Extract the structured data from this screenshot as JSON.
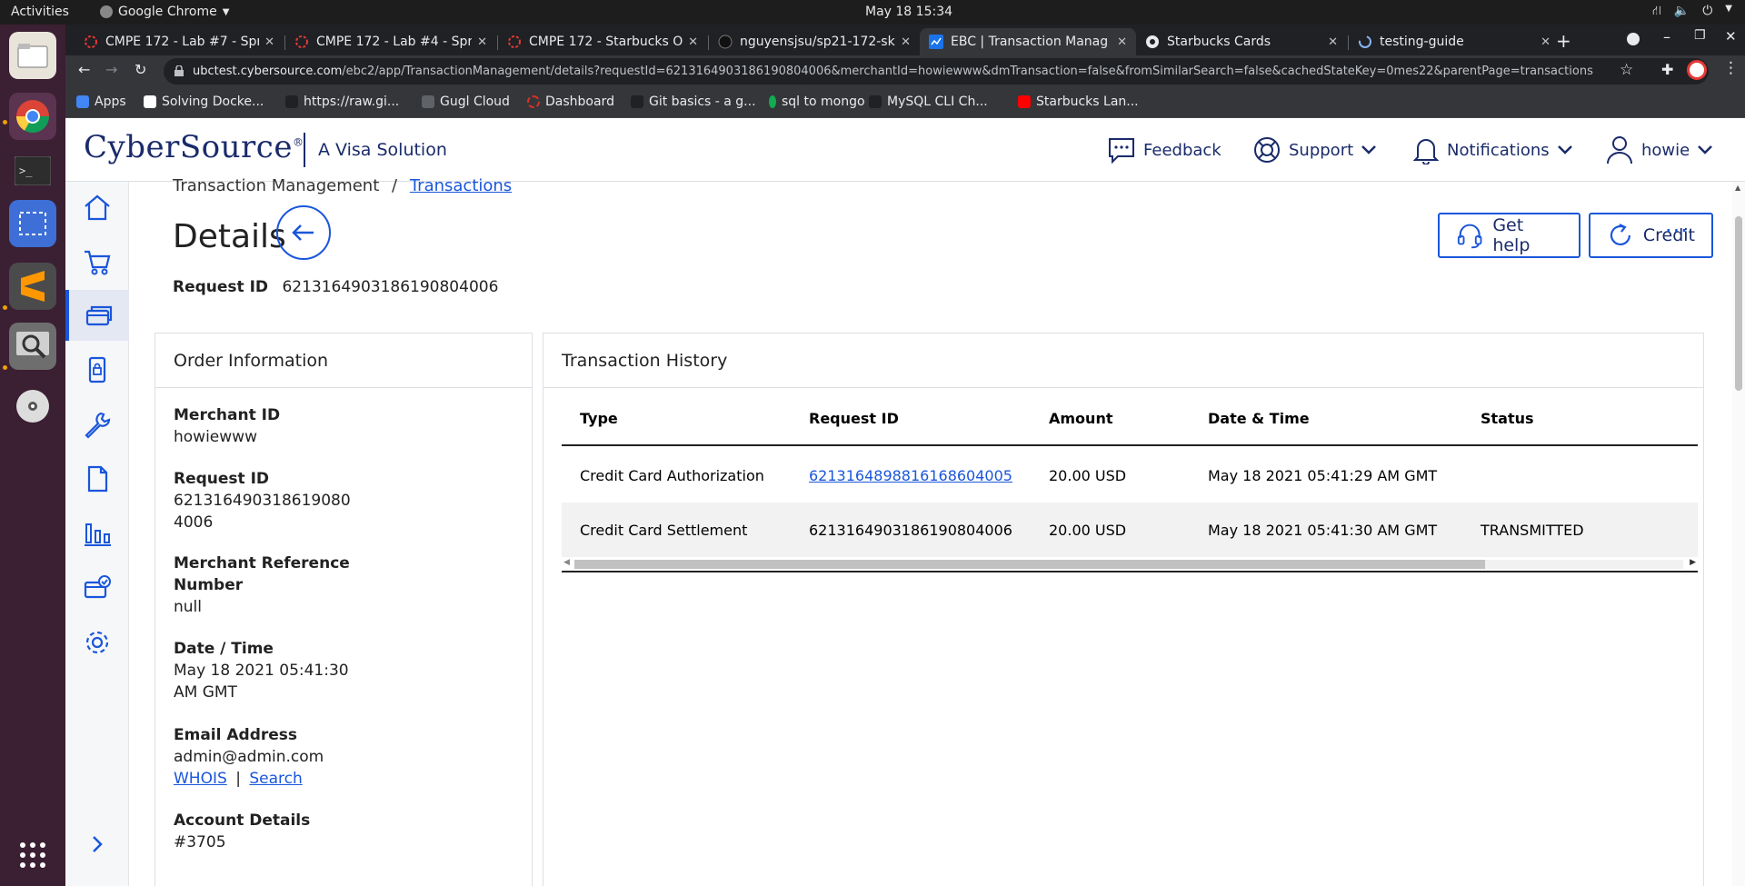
{
  "os": {
    "activities": "Activities",
    "app_name": "Google Chrome",
    "clock": "May 18  15:34"
  },
  "tabs": [
    {
      "title": "CMPE 172 - Lab #7 - Sprin",
      "active": false
    },
    {
      "title": "CMPE 172 - Lab #4 - Sprin",
      "active": false
    },
    {
      "title": "CMPE 172 - Starbucks Or",
      "active": false
    },
    {
      "title": "nguyensjsu/sp21-172-sk",
      "active": false
    },
    {
      "title": "EBC | Transaction Manag",
      "active": true
    },
    {
      "title": "Starbucks Cards",
      "active": false
    },
    {
      "title": "testing-guide",
      "active": false
    }
  ],
  "url": {
    "host": "ubctest.cybersource.com",
    "path": "/ebc2/app/TransactionManagement/details?requestId=6213164903186190804006&merchantId=howiewww&dmTransaction=false&fromSimilarSearch=false&cachedStateKey=0mes22&parentPage=transactions"
  },
  "bookmarks": [
    {
      "label": "Apps",
      "color": "#4285f4"
    },
    {
      "label": "Solving Docke...",
      "color": "#ffffff"
    },
    {
      "label": "https://raw.gi...",
      "color": "#5f6368"
    },
    {
      "label": "Gugl Cloud",
      "color": "#5f6368"
    },
    {
      "label": "Dashboard",
      "color": "#d93025"
    },
    {
      "label": "Git basics - a g...",
      "color": "#5f6368"
    },
    {
      "label": "sql to mongo",
      "color": "#13aa52"
    },
    {
      "label": "MySQL CLI Ch...",
      "color": "#5f6368"
    },
    {
      "label": "Starbucks Lan...",
      "color": "#ff0000"
    }
  ],
  "header": {
    "brand": "CyberSource",
    "brand_mark": "®",
    "tagline": "A Visa Solution",
    "feedback": "Feedback",
    "support": "Support",
    "notifications": "Notifications",
    "user": "howie"
  },
  "breadcrumb": {
    "root": "Transaction Management",
    "sep": "/",
    "link": "Transactions"
  },
  "page": {
    "title": "Details",
    "request_id_label": "Request ID",
    "request_id": "6213164903186190804006",
    "get_help": "Get help",
    "credit": "Credit",
    "more": "···"
  },
  "order_info": {
    "title": "Order Information",
    "merchant_id_label": "Merchant ID",
    "merchant_id": "howiewww",
    "request_id_label": "Request ID",
    "request_id_line1": "621316490318619080",
    "request_id_line2": "4006",
    "ref_label_line1": "Merchant Reference",
    "ref_label_line2": "Number",
    "ref_value": "null",
    "datetime_label": "Date / Time",
    "datetime_line1": "May 18 2021 05:41:30",
    "datetime_line2": "AM GMT",
    "email_label": "Email Address",
    "email": "admin@admin.com",
    "whois": "WHOIS",
    "pipe": "|",
    "search": "Search",
    "account_label": "Account Details",
    "account": "#3705"
  },
  "history": {
    "title": "Transaction History",
    "columns": [
      "Type",
      "Request ID",
      "Amount",
      "Date & Time",
      "Status"
    ],
    "rows": [
      {
        "type": "Credit Card Authorization",
        "request_id": "6213164898816168604005",
        "amount": "20.00 USD",
        "datetime": "May 18 2021 05:41:29 AM GMT",
        "status": "",
        "link": true
      },
      {
        "type": "Credit Card Settlement",
        "request_id": "6213164903186190804006",
        "amount": "20.00 USD",
        "datetime": "May 18 2021 05:41:30 AM GMT",
        "status": "TRANSMITTED",
        "link": false
      }
    ]
  },
  "colors": {
    "accent": "#1a56db",
    "brand_navy": "#1a2b6b",
    "dock": "#3b1f33"
  }
}
